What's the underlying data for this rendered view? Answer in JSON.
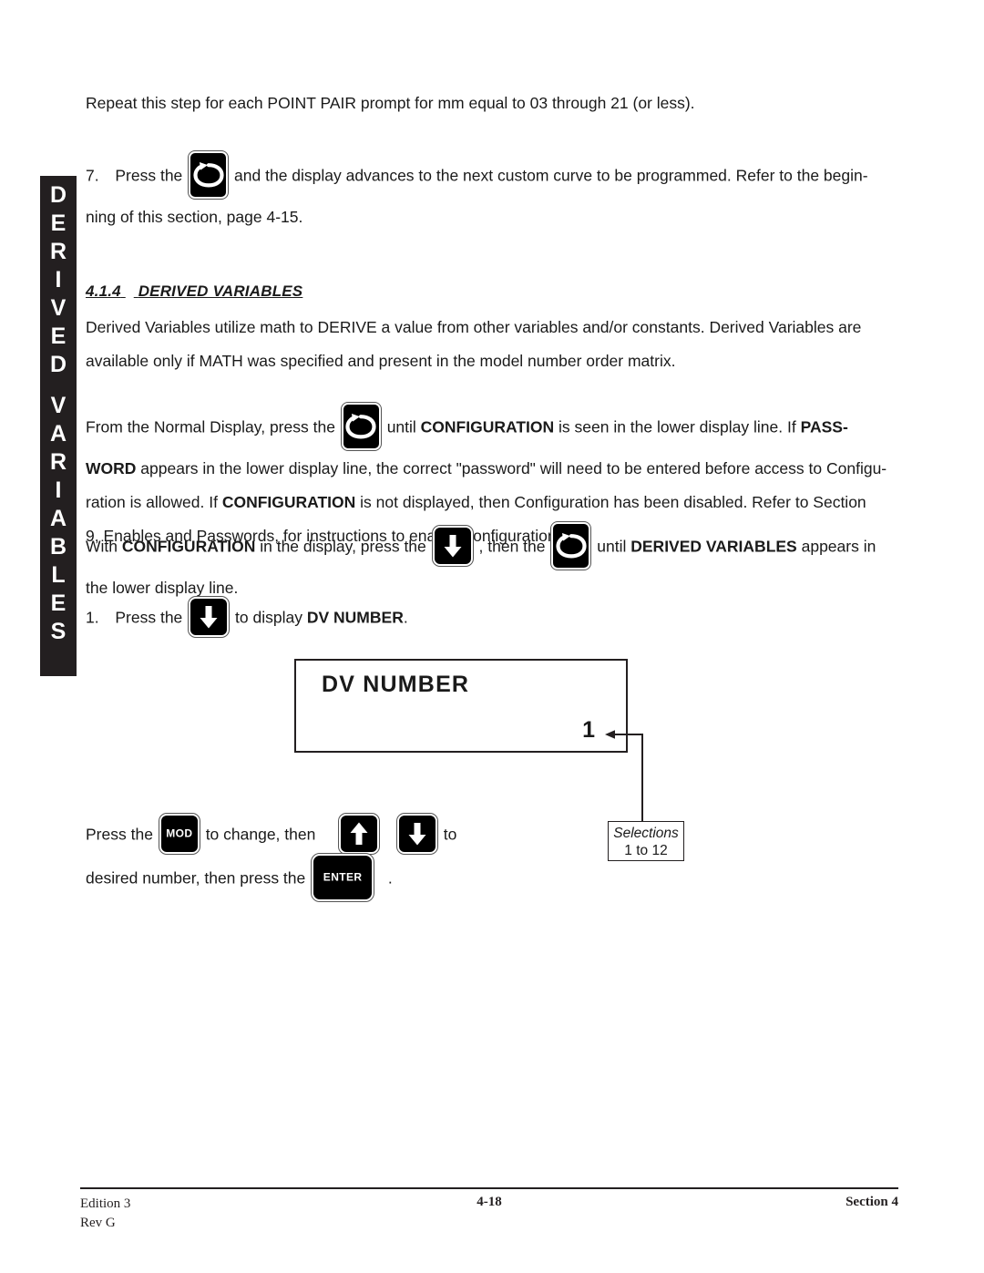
{
  "side_tab": {
    "name": "DERIVED VARIABLES",
    "lines": [
      "D",
      "E",
      "R",
      "I",
      "V",
      "E",
      "D",
      "V",
      "A",
      "R",
      "I",
      "A",
      "B",
      "L",
      "E",
      "S"
    ]
  },
  "intro": {
    "text": "Repeat this step for each POINT PAIR prompt for mm equal to 03 through 21 (or less)."
  },
  "step7": {
    "number": "7.",
    "before_icon": "Press  the",
    "after_icon": "and the display advances to the next custom curve to be programmed.  Refer to the begin-",
    "line2": "ning of this section, page 4-15.",
    "icon": "loop-arrow-icon"
  },
  "section": {
    "number": "4.1.4",
    "title": "DERIVED VARIABLES"
  },
  "derived_paragraph": {
    "line1": "Derived Variables utilize math to DERIVE a value from other variables and/or constants.  Derived Variables are",
    "line2": "available only if MATH was specified and present in the model number order matrix."
  },
  "config_paragraph": {
    "p1_a": "From the Normal Display, press the",
    "p1_b": "until",
    "p1_bold1": "CONFIGURATION",
    "p1_c": "is seen in the lower display line.  If",
    "p1_bold2": "PASS-",
    "p2_bold": "WORD",
    "p2_a": "appears in the lower display line, the correct \"password\" will need to be entered before access to Configu-",
    "p3_a": "ration is allowed.  If",
    "p3_bold": "CONFIGURATION",
    "p3_b": "is not displayed, then Configuration has been disabled.  Refer to Section",
    "p4": "9, Enables and Passwords, for instructions to enable Configuration."
  },
  "with_paragraph": {
    "a": "With",
    "bold1": "CONFIGURATION",
    "b": "in the display, press the",
    "c": ", then the",
    "d": "until",
    "bold2": "DERIVED VARIABLES",
    "e": "appears in",
    "line2": "the lower display line."
  },
  "step1": {
    "number": "1.",
    "before_icon": "Press the",
    "after_icon": "to display",
    "bold": "DV NUMBER",
    "period": "."
  },
  "lcd": {
    "upper_line": "DV  NUMBER",
    "lower_line": "1"
  },
  "callout": {
    "line1": "Selections",
    "line2": "1 to 12"
  },
  "press_instruction": {
    "a": "Press the",
    "b": "to  change,  then",
    "c": "to",
    "line2_a": "desired number, then press the",
    "line2_b": "."
  },
  "buttons": {
    "mod_label": "MOD",
    "enter_label": "ENTER",
    "loop_icon": "loop-arrow-icon",
    "down_icon": "down-arrow-icon",
    "up_icon": "up-arrow-icon"
  },
  "footer": {
    "edition": "Edition 3",
    "rev": "Rev G",
    "page": "4-18",
    "section": "Section 4"
  }
}
